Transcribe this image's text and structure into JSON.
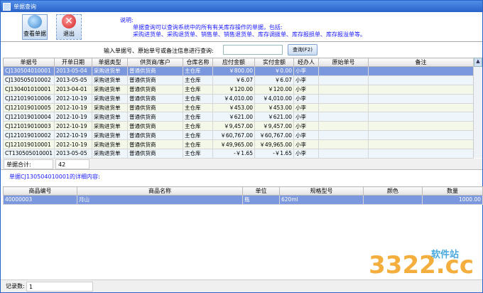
{
  "window": {
    "title": "单据查询"
  },
  "toolbar": {
    "view_label": "查看单据",
    "exit_label": "退出"
  },
  "description": {
    "heading": "说明:",
    "line1": "单据查询可以查询系统中的所有有关库存操作的单据，包括:",
    "line2": "采购进货单、采购退货单、销售单、销售退货单、库存调拨单、库存报损单、库存报溢单等。"
  },
  "search": {
    "label": "输入单据号、原始单号或备注信息进行查询:",
    "value": "",
    "button": "查询(F2)"
  },
  "bills": {
    "columns": [
      "单据号",
      "开单日期",
      "单据类型",
      "供货商/客户",
      "仓库名称",
      "应付金额",
      "实付金额",
      "经办人",
      "原始单号",
      "备注"
    ],
    "rows": [
      [
        "CJ130504010001",
        "2013-05-04",
        "采购进货单",
        "普通供货商",
        "主仓库",
        "￥800.00",
        "￥0.00",
        "小李",
        "",
        ""
      ],
      [
        "CJ130505010002",
        "2013-05-05",
        "采购进货单",
        "普通供货商",
        "主仓库",
        "￥6.07",
        "￥6.07",
        "小李",
        "",
        ""
      ],
      [
        "CJ130401010001",
        "2013-04-01",
        "采购进货单",
        "普通供货商",
        "主仓库",
        "￥120.00",
        "￥120.00",
        "小李",
        "",
        ""
      ],
      [
        "CJ121019010006",
        "2012-10-19",
        "采购进货单",
        "普通供货商",
        "主仓库",
        "￥4,010.00",
        "￥4,010.00",
        "小李",
        "",
        ""
      ],
      [
        "CJ121019010005",
        "2012-10-19",
        "采购进货单",
        "普通供货商",
        "主仓库",
        "￥453.00",
        "￥453.00",
        "小李",
        "",
        ""
      ],
      [
        "CJ121019010004",
        "2012-10-19",
        "采购进货单",
        "普通供货商",
        "主仓库",
        "￥621.00",
        "￥621.00",
        "小李",
        "",
        ""
      ],
      [
        "CJ121019010003",
        "2012-10-19",
        "采购进货单",
        "普通供货商",
        "主仓库",
        "￥9,457.00",
        "￥9,457.00",
        "小李",
        "",
        ""
      ],
      [
        "CJ121019010002",
        "2012-10-19",
        "采购进货单",
        "普通供货商",
        "主仓库",
        "￥60,767.00",
        "￥60,767.00",
        "小李",
        "",
        ""
      ],
      [
        "CJ121019010001",
        "2012-10-19",
        "采购进货单",
        "普通供货商",
        "主仓库",
        "￥49,965.00",
        "￥49,965.00",
        "小李",
        "",
        ""
      ],
      [
        "CT130505010001",
        "2013-05-05",
        "采购退货单",
        "普通供货商",
        "主仓库",
        "-￥1.65",
        "-￥1.65",
        "小李",
        "",
        ""
      ]
    ]
  },
  "summary": {
    "label": "单据合计:",
    "value": "42"
  },
  "detail": {
    "label": "单据CJ130504010001的详细内容:",
    "columns": [
      "商品编号",
      "商品名称",
      "单位",
      "规格型号",
      "颜色",
      "数量"
    ],
    "rows": [
      [
        "40000003",
        "月山",
        "瓶",
        "620ml",
        "",
        "1000.00"
      ]
    ]
  },
  "status": {
    "label": "记录数:",
    "value": "1"
  },
  "watermark": {
    "text": "3322.cc",
    "sub": "软件站"
  },
  "colors": {
    "selected_row": "#7b97dd",
    "title_bar": "#2a62c8",
    "description_text": "#1a1aff"
  }
}
